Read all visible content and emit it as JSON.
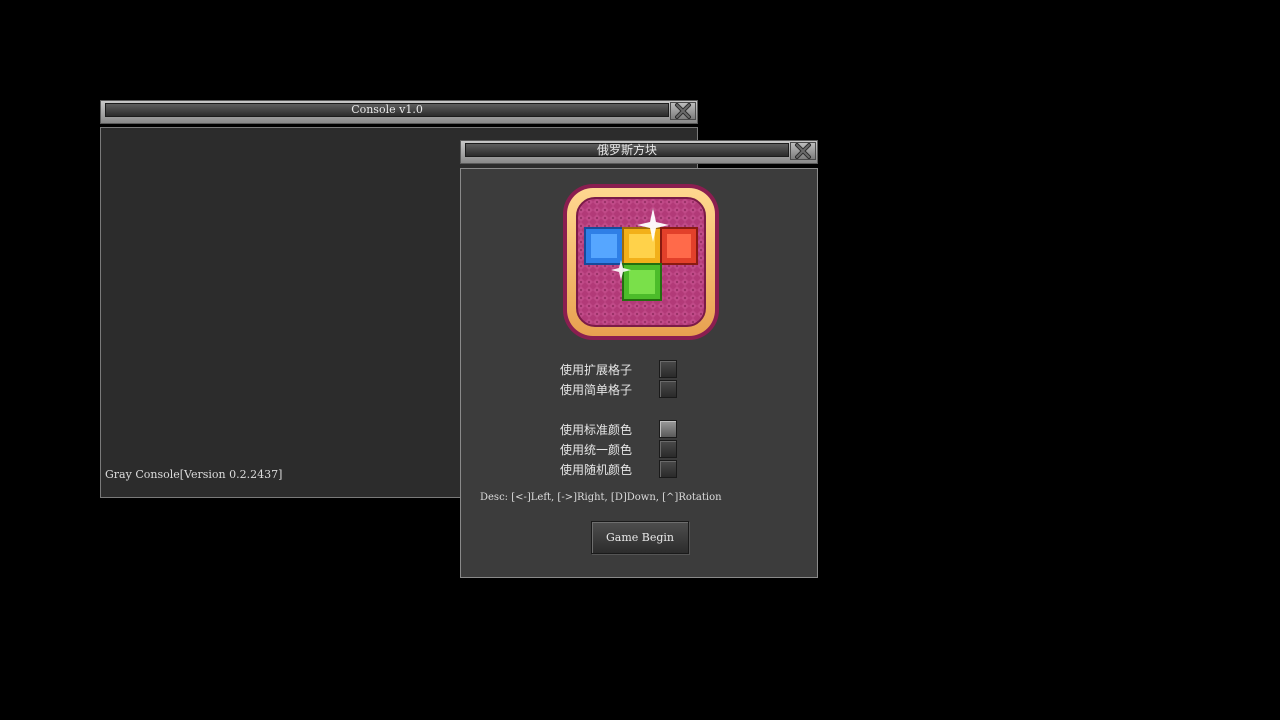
{
  "console_window": {
    "title": "Console v1.0",
    "output_line": "Gray Console[Version 0.2.2437]"
  },
  "game_window": {
    "title": "俄罗斯方块",
    "logo_icon": "tetris-logo-icon",
    "options": [
      {
        "label": "使用扩展格子",
        "checked": false
      },
      {
        "label": "使用简单格子",
        "checked": false
      },
      {
        "label": "使用标准颜色",
        "checked": true
      },
      {
        "label": "使用统一颜色",
        "checked": false
      },
      {
        "label": "使用随机颜色",
        "checked": false
      }
    ],
    "desc": "Desc: [<-]Left, [->]Right, [D]Down, [^]Rotation",
    "begin_button": "Game Begin"
  },
  "colors": {
    "background": "#000000",
    "console_body": "#2c2c2c",
    "game_body": "#3c3c3c",
    "block_blue": "#2f7fe6",
    "block_yellow": "#f2b01a",
    "block_red": "#e2402a",
    "block_green": "#4cbc2a",
    "logo_pink": "#b23a78",
    "logo_gold": "#f4c06a"
  }
}
